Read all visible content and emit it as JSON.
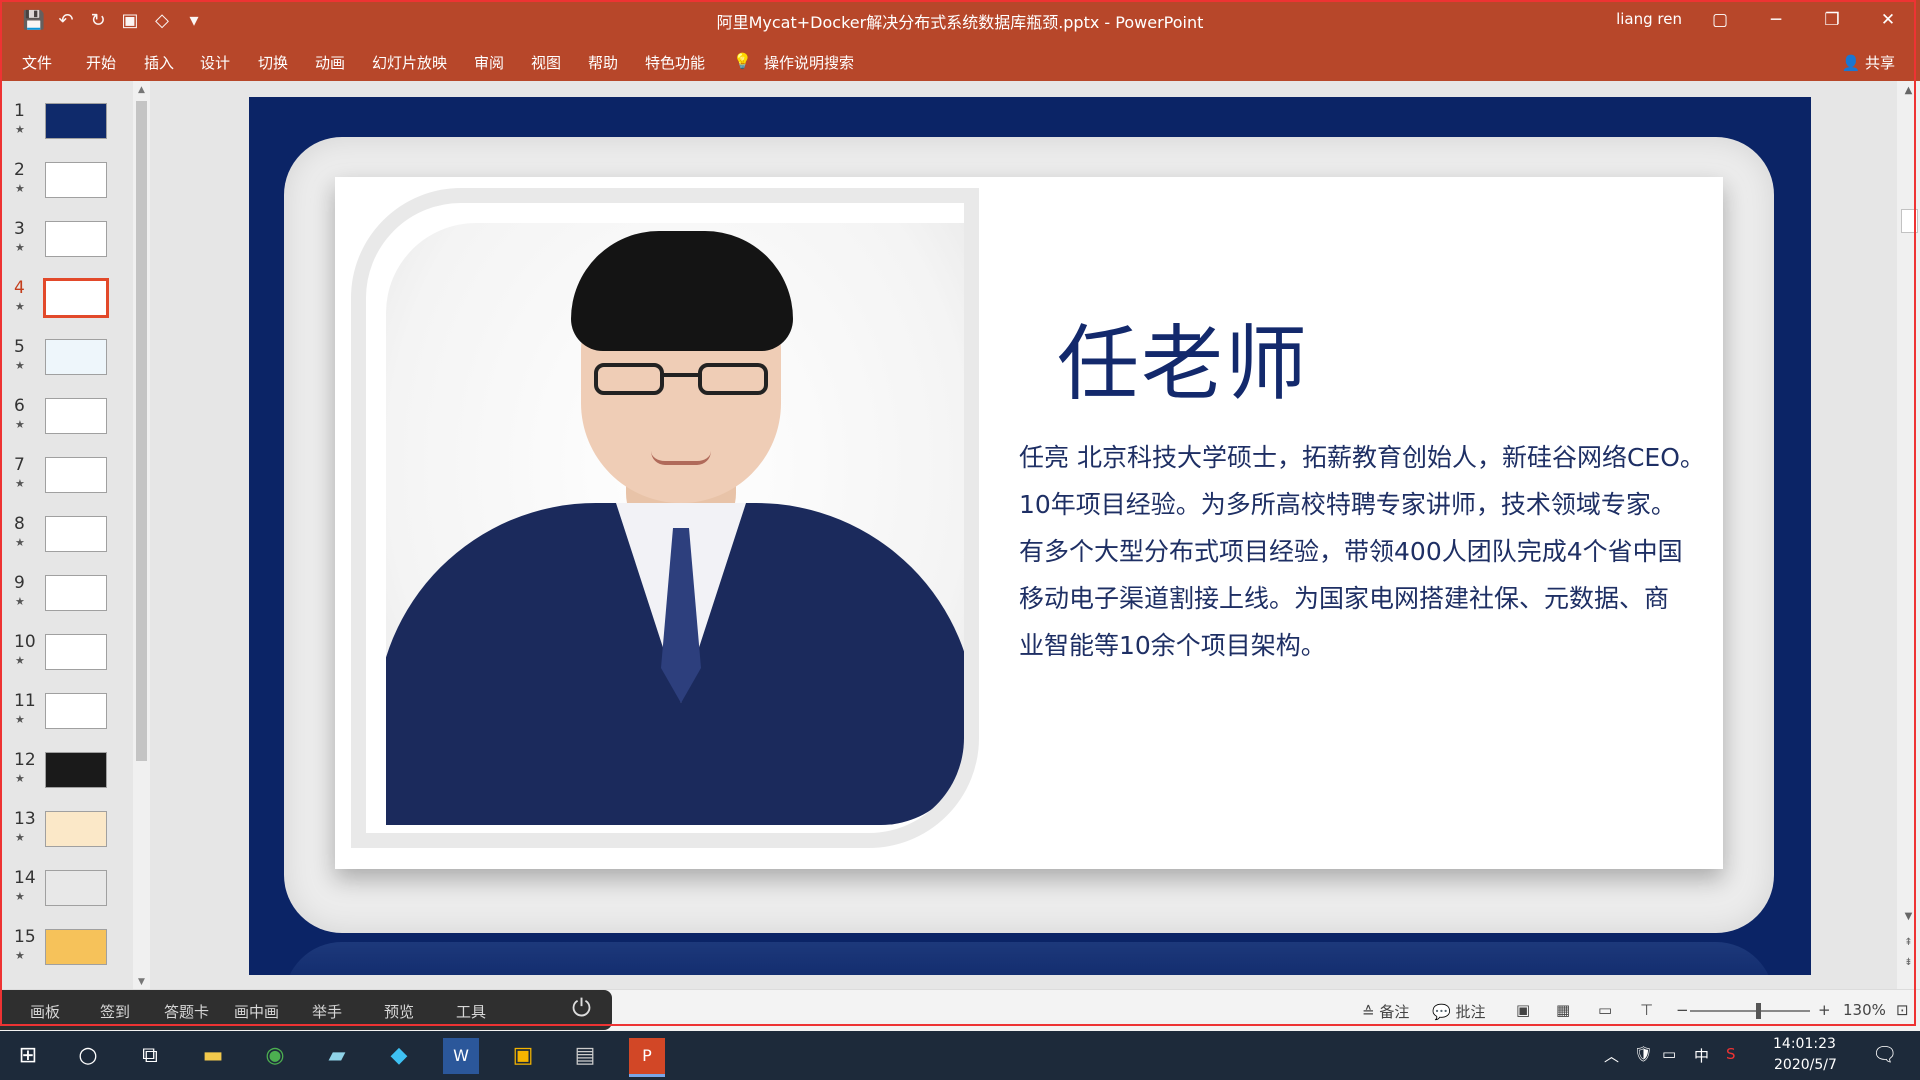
{
  "window": {
    "title": "阿里Mycat+Docker解决分布式系统数据库瓶颈.pptx - PowerPoint",
    "user": "liang ren",
    "controls": {
      "ribbon_display": "▢",
      "minimize": "─",
      "restore": "❐",
      "close": "✕"
    }
  },
  "quick_access": [
    "💾",
    "↶",
    "↻",
    "▣",
    "◇",
    "▾"
  ],
  "ribbon": {
    "tabs": [
      "文件",
      "开始",
      "插入",
      "设计",
      "切换",
      "动画",
      "幻灯片放映",
      "审阅",
      "视图",
      "帮助",
      "特色功能"
    ],
    "search_label": "操作说明搜索",
    "share_label": "共享"
  },
  "thumbnails": [
    {
      "num": "1"
    },
    {
      "num": "2"
    },
    {
      "num": "3"
    },
    {
      "num": "4"
    },
    {
      "num": "5"
    },
    {
      "num": "6"
    },
    {
      "num": "7"
    },
    {
      "num": "8"
    },
    {
      "num": "9"
    },
    {
      "num": "10"
    },
    {
      "num": "11"
    },
    {
      "num": "12"
    },
    {
      "num": "13"
    },
    {
      "num": "14"
    },
    {
      "num": "15"
    }
  ],
  "active_slide": 4,
  "slide": {
    "name": "任老师",
    "bio_lines": [
      "任亮 北京科技大学硕士，拓薪教育创始人，新硅谷网络CEO。",
      "10年项目经验。为多所高校特聘专家讲师，技术领域专家。",
      "有多个大型分布式项目经验，带领400人团队完成4个省中国",
      "移动电子渠道割接上线。为国家电网搭建社保、元数据、商",
      "业智能等10余个项目架构。"
    ],
    "colors": {
      "background": "#0b2466",
      "name": "#13296c",
      "text": "#1e2f64"
    }
  },
  "statusbar": {
    "notes_label": "备注",
    "comments_label": "批注",
    "zoom_level": "130%"
  },
  "classroom_toolbar": {
    "tools": [
      "画板",
      "签到",
      "答题卡",
      "画中画",
      "举手",
      "预览",
      "工具"
    ]
  },
  "taskbar": {
    "time": "14:01:23",
    "date": "2020/5/7",
    "ime": "中"
  }
}
